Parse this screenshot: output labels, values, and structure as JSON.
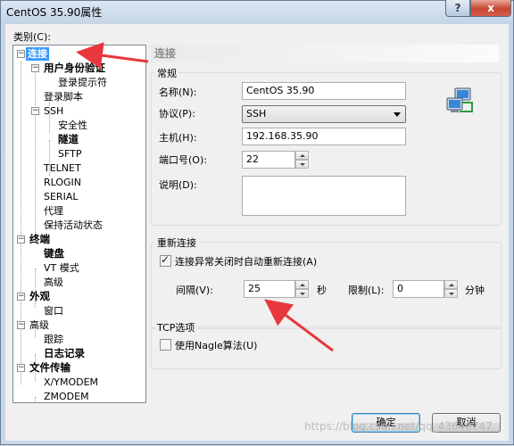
{
  "window": {
    "title": "CentOS 35.90属性",
    "help": "?",
    "close": "x"
  },
  "category_label": "类别(C):",
  "tree": [
    {
      "label": "连接"
    },
    {
      "label": "用户身份验证"
    },
    {
      "label": "登录提示符"
    },
    {
      "label": "登录脚本"
    },
    {
      "label": "SSH"
    },
    {
      "label": "安全性"
    },
    {
      "label": "隧道"
    },
    {
      "label": "SFTP"
    },
    {
      "label": "TELNET"
    },
    {
      "label": "RLOGIN"
    },
    {
      "label": "SERIAL"
    },
    {
      "label": "代理"
    },
    {
      "label": "保持活动状态"
    },
    {
      "label": "终端"
    },
    {
      "label": "键盘"
    },
    {
      "label": "VT 模式"
    },
    {
      "label": "高级"
    },
    {
      "label": "外观"
    },
    {
      "label": "窗口"
    },
    {
      "label": "高级"
    },
    {
      "label": "跟踪"
    },
    {
      "label": "日志记录"
    },
    {
      "label": "文件传输"
    },
    {
      "label": "X/YMODEM"
    },
    {
      "label": "ZMODEM"
    }
  ],
  "page_title": "连接",
  "general": {
    "title": "常规",
    "name_label": "名称(N):",
    "name_value": "CentOS 35.90",
    "protocol_label": "协议(P):",
    "protocol_value": "SSH",
    "host_label": "主机(H):",
    "host_value": "192.168.35.90",
    "port_label": "端口号(O):",
    "port_value": "22",
    "desc_label": "说明(D):",
    "desc_value": ""
  },
  "reconnect": {
    "title": "重新连接",
    "auto_label": "连接异常关闭时自动重新连接(A)",
    "auto_checked": true,
    "interval_label": "间隔(V):",
    "interval_value": "25",
    "interval_unit": "秒",
    "limit_label": "限制(L):",
    "limit_value": "0",
    "limit_unit": "分钟"
  },
  "tcp": {
    "title": "TCP选项",
    "nagle_label": "使用Nagle算法(U)",
    "nagle_checked": false
  },
  "buttons": {
    "ok": "确定",
    "cancel": "取消"
  },
  "watermark": "https://blog.csdn.net/qq_43640747",
  "colors": {
    "selection": "#3399ff",
    "arrow": "#e8383d"
  }
}
